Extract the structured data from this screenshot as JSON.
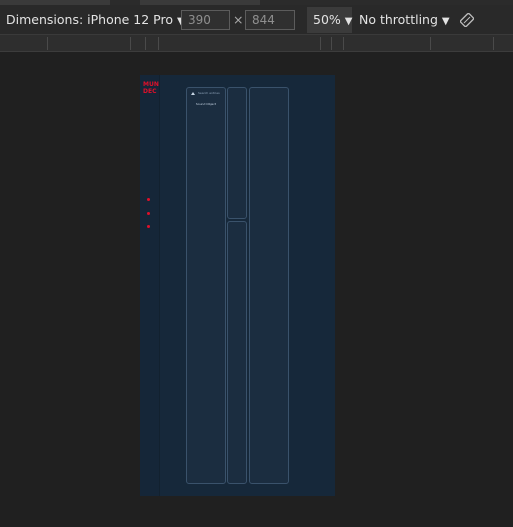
{
  "toolbar": {
    "dimensions_label": "Dimensions: iPhone 12 Pro",
    "width_value": "390",
    "times_symbol": "×",
    "height_value": "844",
    "zoom_label": "50%",
    "throttling_label": "No throttling",
    "caret": "▼",
    "rotate_icon": "rotate-icon"
  },
  "device": {
    "logo_line1": "MUN",
    "logo_line2": "DEC",
    "search_placeholder": "Search entries",
    "panel_title": "Sound Object"
  },
  "colors": {
    "background": "#202020",
    "device_bg": "#16283a",
    "accent": "#e0102a"
  }
}
